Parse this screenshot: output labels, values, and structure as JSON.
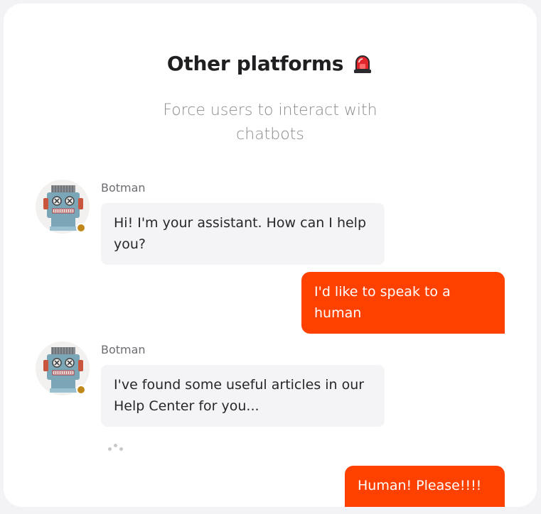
{
  "header": {
    "title": "Other platforms",
    "title_icon": "siren-icon",
    "subtitle": "Force users to interact with chatbots"
  },
  "colors": {
    "accent": "#ff4100",
    "bot_bubble": "#f4f4f6",
    "status_dot": "#c0881a"
  },
  "messages": [
    {
      "from": "bot",
      "sender": "Botman",
      "text": "Hi! I'm your assistant. How can I help you?"
    },
    {
      "from": "user",
      "text": "I'd like to speak to a human"
    },
    {
      "from": "bot",
      "sender": "Botman",
      "text": "I've found some useful articles in our Help Center for you..."
    },
    {
      "from": "user",
      "text": "Human! Please!!!!"
    }
  ],
  "typing_indicator": "bot-typing-icon"
}
